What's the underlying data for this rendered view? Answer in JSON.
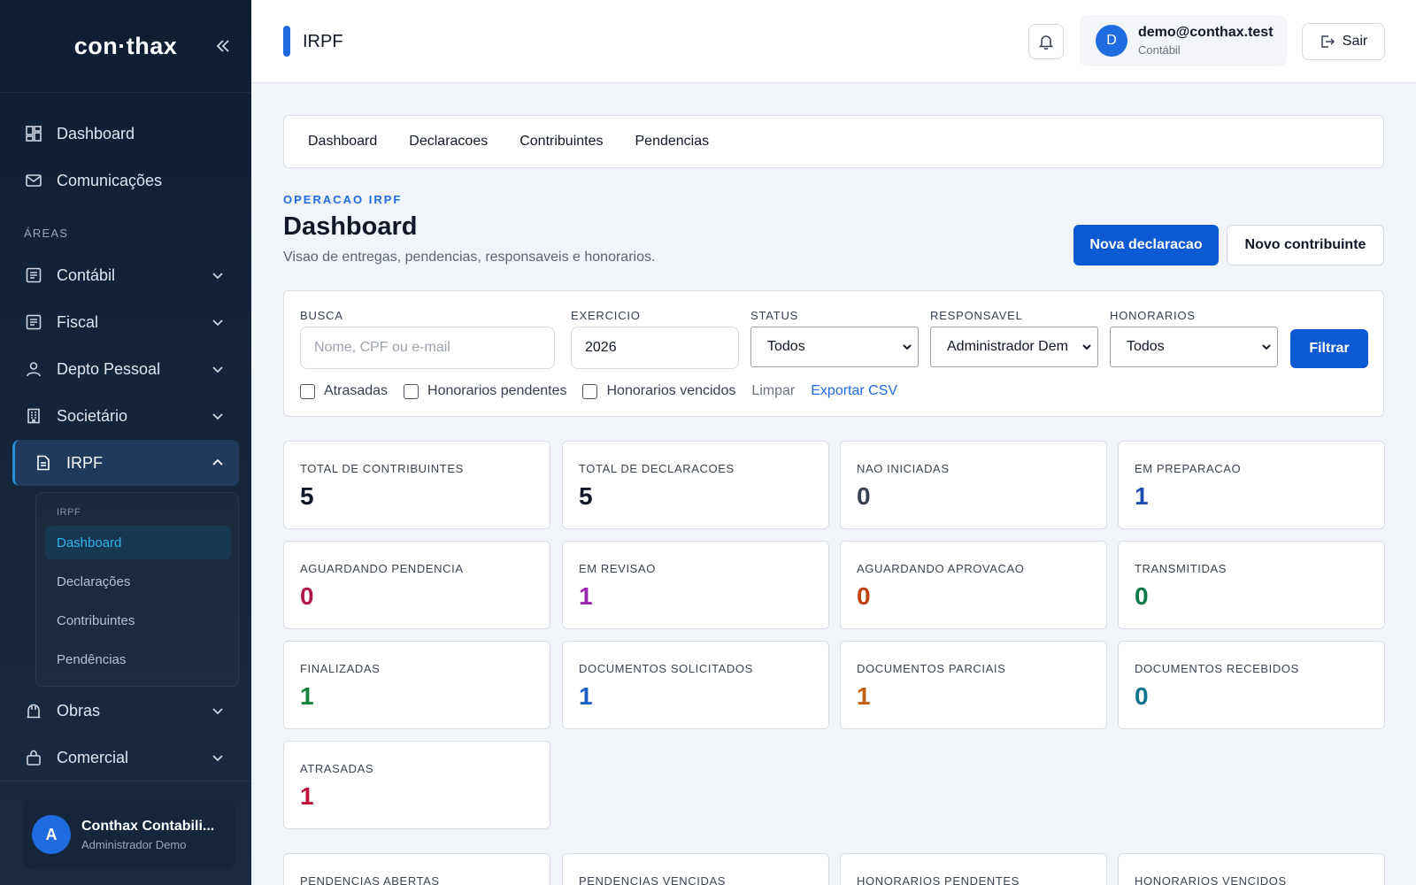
{
  "sidebar": {
    "logo": "con·thax",
    "top_items": [
      {
        "label": "Dashboard",
        "icon": "grid-icon"
      },
      {
        "label": "Comunicações",
        "icon": "mail-icon"
      }
    ],
    "section_label": "ÁREAS",
    "areas": [
      {
        "label": "Contábil",
        "icon": "ledger-icon"
      },
      {
        "label": "Fiscal",
        "icon": "ledger-icon"
      },
      {
        "label": "Depto Pessoal",
        "icon": "user-icon"
      },
      {
        "label": "Societário",
        "icon": "building-icon"
      },
      {
        "label": "IRPF",
        "icon": "document-icon"
      },
      {
        "label": "Obras",
        "icon": "crane-icon"
      },
      {
        "label": "Comercial",
        "icon": "bag-icon"
      }
    ],
    "submenu": {
      "label": "IRPF",
      "items": [
        "Dashboard",
        "Declarações",
        "Contribuintes",
        "Pendências"
      ],
      "active": "Dashboard"
    },
    "footer": {
      "avatar": "A",
      "name": "Conthax Contabili...",
      "role": "Administrador Demo"
    }
  },
  "topbar": {
    "title": "IRPF",
    "account_avatar": "D",
    "account_email": "demo@conthax.test",
    "account_role": "Contábil",
    "logout_label": "Sair"
  },
  "tabs": [
    "Dashboard",
    "Declaracoes",
    "Contribuintes",
    "Pendencias"
  ],
  "header": {
    "eyebrow": "OPERACAO IRPF",
    "title": "Dashboard",
    "subtitle": "Visao de entregas, pendencias, responsaveis e honorarios.",
    "primary_action": "Nova declaracao",
    "secondary_action": "Novo contribuinte"
  },
  "filters": {
    "busca_label": "BUSCA",
    "busca_placeholder": "Nome, CPF ou e-mail",
    "exercicio_label": "EXERCICIO",
    "exercicio_value": "2026",
    "status_label": "STATUS",
    "status_value": "Todos",
    "responsavel_label": "RESPONSAVEL",
    "responsavel_value": "Administrador Dem",
    "honorarios_label": "HONORARIOS",
    "honorarios_value": "Todos",
    "filter_button": "Filtrar",
    "checkboxes": [
      "Atrasadas",
      "Honorarios pendentes",
      "Honorarios vencidos"
    ],
    "clear_link": "Limpar",
    "export_link": "Exportar CSV"
  },
  "stats": [
    {
      "label": "TOTAL DE CONTRIBUINTES",
      "value": "5",
      "color": "#111827"
    },
    {
      "label": "TOTAL DE DECLARACOES",
      "value": "5",
      "color": "#111827"
    },
    {
      "label": "NAO INICIADAS",
      "value": "0",
      "color": "#374151"
    },
    {
      "label": "EM PREPARACAO",
      "value": "1",
      "color": "#1d4fae"
    },
    {
      "label": "AGUARDANDO PENDENCIA",
      "value": "0",
      "color": "#b0174f"
    },
    {
      "label": "EM REVISAO",
      "value": "1",
      "color": "#9b27b0"
    },
    {
      "label": "AGUARDANDO APROVACAO",
      "value": "0",
      "color": "#c2410c"
    },
    {
      "label": "TRANSMITIDAS",
      "value": "0",
      "color": "#0f7a4a"
    },
    {
      "label": "FINALIZADAS",
      "value": "1",
      "color": "#15803d"
    },
    {
      "label": "DOCUMENTOS SOLICITADOS",
      "value": "1",
      "color": "#1d5fc9"
    },
    {
      "label": "DOCUMENTOS PARCIAIS",
      "value": "1",
      "color": "#c05f10"
    },
    {
      "label": "DOCUMENTOS RECEBIDOS",
      "value": "0",
      "color": "#0e7490"
    },
    {
      "label": "ATRASADAS",
      "value": "1",
      "color": "#be123c"
    },
    {
      "label": "PENDENCIAS ABERTAS",
      "value": "",
      "color": "#111827"
    },
    {
      "label": "PENDENCIAS VENCIDAS",
      "value": "",
      "color": "#111827"
    },
    {
      "label": "HONORARIOS PENDENTES",
      "value": "",
      "color": "#111827"
    },
    {
      "label": "HONORARIOS VENCIDOS",
      "value": "",
      "color": "#111827"
    }
  ]
}
